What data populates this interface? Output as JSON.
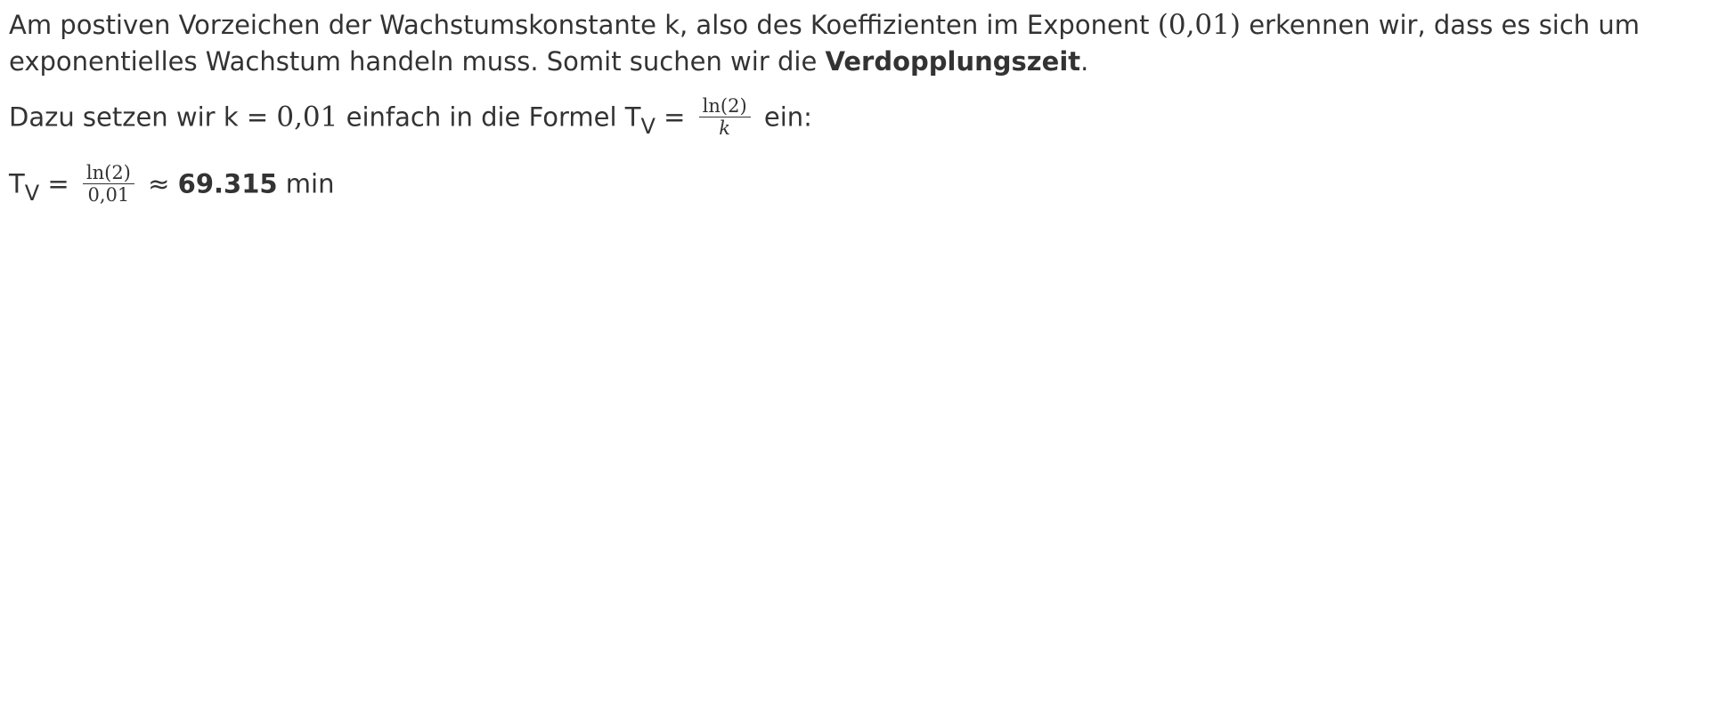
{
  "paragraph1": {
    "text_a": "Am postiven Vorzeichen der Wachstumskonstante k, also des Koeffizienten im Exponent ",
    "coefficient": "(0,01)",
    "text_b": " erkennen wir, dass es sich um exponentielles Wachstum handeln muss. Somit suchen wir die ",
    "bold_term": "Verdopplungszeit",
    "text_c": "."
  },
  "paragraph2": {
    "text_a": "Dazu setzen wir k = ",
    "k_value": "0,01",
    "text_b": " einfach in die Formel T",
    "subscript": "V",
    "equals": " = ",
    "fraction_numerator": "ln(2)",
    "fraction_denominator": "k",
    "text_c": " ein:"
  },
  "paragraph3": {
    "symbol": "T",
    "subscript": "V",
    "equals": " = ",
    "fraction_numerator": "ln(2)",
    "fraction_denominator": "0,01",
    "approx": " ≈ ",
    "result_value": "69.315",
    "unit": " min"
  }
}
